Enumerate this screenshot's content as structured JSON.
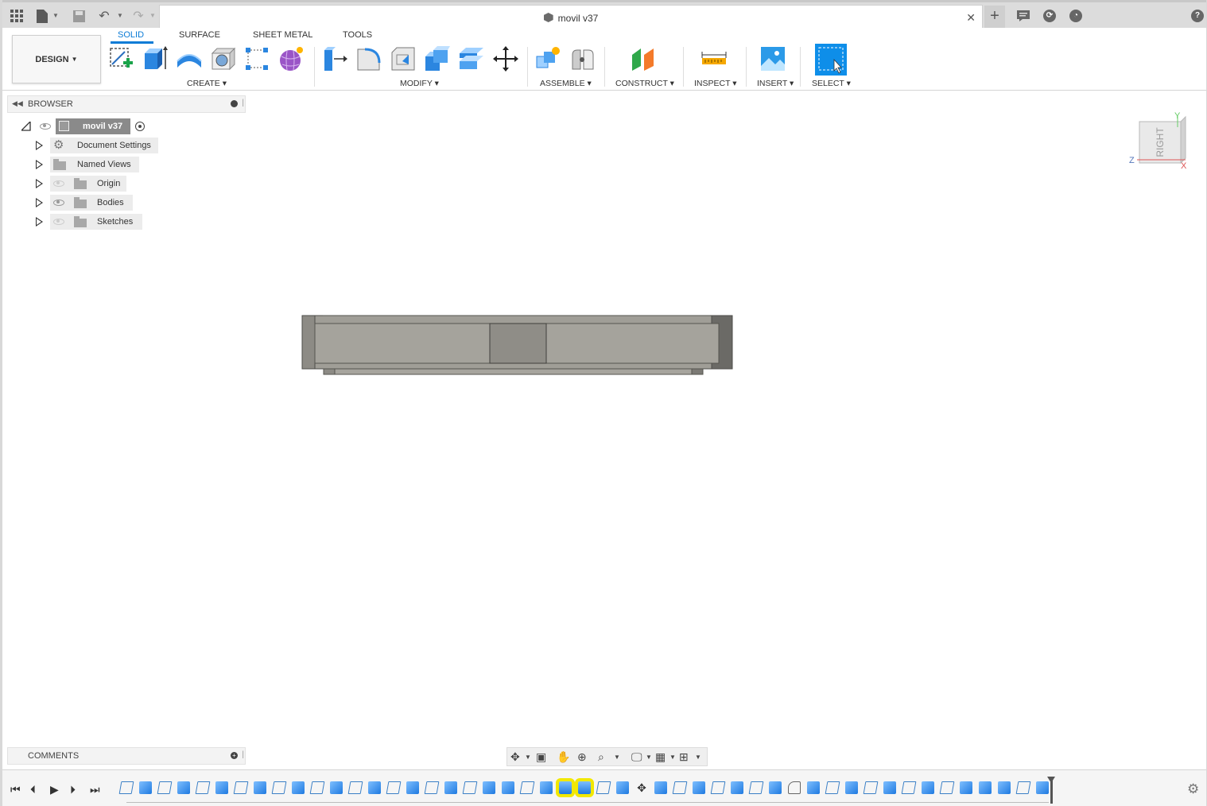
{
  "window": {
    "title": "movil v37"
  },
  "ribbon": {
    "workspace": "DESIGN",
    "tabs": [
      {
        "label": "SOLID",
        "active": true
      },
      {
        "label": "SURFACE",
        "active": false
      },
      {
        "label": "SHEET METAL",
        "active": false
      },
      {
        "label": "TOOLS",
        "active": false
      }
    ],
    "groups": {
      "create": "CREATE",
      "modify": "MODIFY",
      "assemble": "ASSEMBLE",
      "construct": "CONSTRUCT",
      "inspect": "INSPECT",
      "insert": "INSERT",
      "select": "SELECT"
    }
  },
  "browser": {
    "title": "BROWSER",
    "root": "movil v37",
    "items": [
      {
        "label": "Document Settings",
        "icon": "gear-icon"
      },
      {
        "label": "Named Views",
        "icon": "folder-icon"
      },
      {
        "label": "Origin",
        "icon": "folder-icon",
        "visible": false
      },
      {
        "label": "Bodies",
        "icon": "folder-icon",
        "visible": true
      },
      {
        "label": "Sketches",
        "icon": "folder-icon",
        "visible": false
      }
    ]
  },
  "comments": {
    "title": "COMMENTS"
  },
  "viewcube": {
    "face": "RIGHT",
    "axes": {
      "y": "Y",
      "z": "Z",
      "x": "X"
    }
  },
  "colors": {
    "accent": "#0a7bd6",
    "highlight": "#f2e800",
    "body": "#a09e97"
  }
}
